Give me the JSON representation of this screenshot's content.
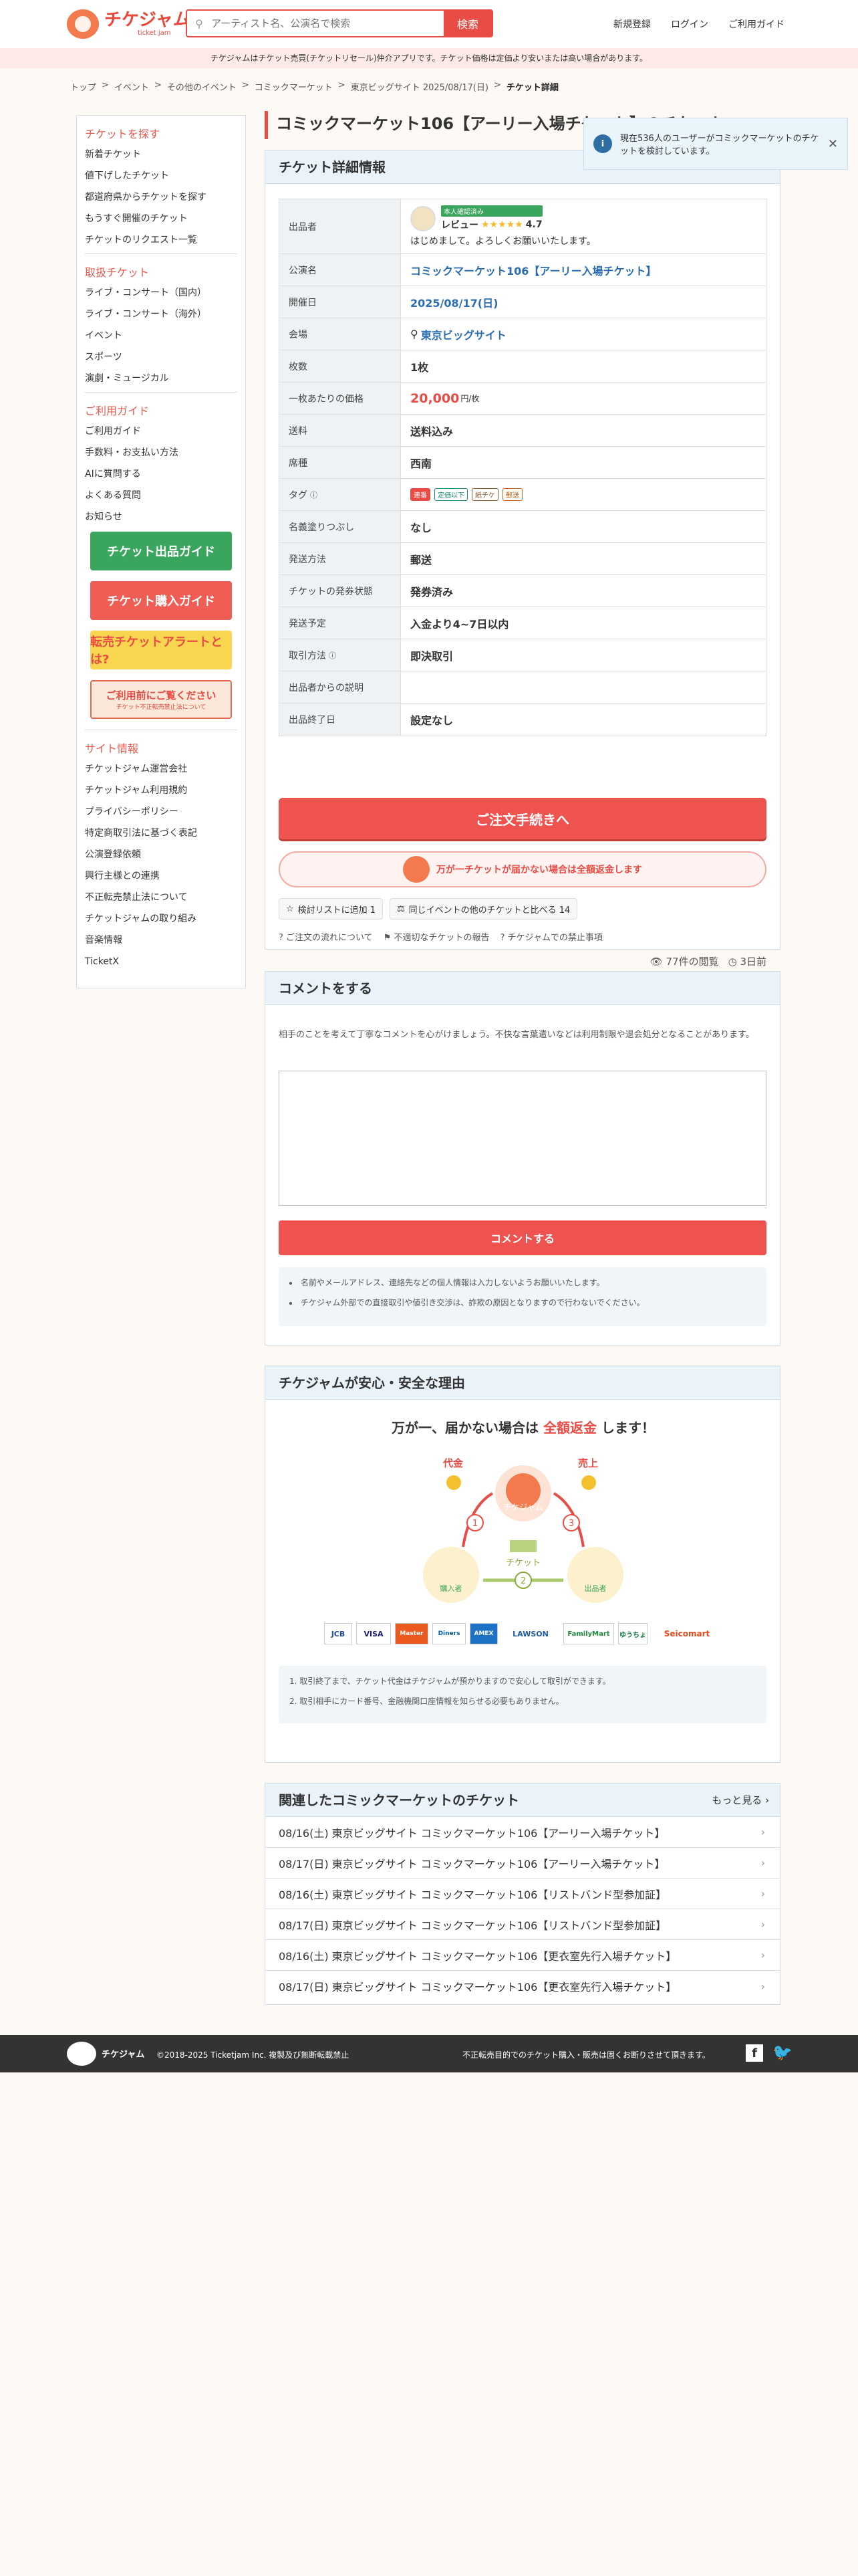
{
  "header": {
    "logo_text": "チケジャム",
    "logo_sub": "ticket jam",
    "search_placeholder": "アーティスト名、公演名で検索",
    "search_button": "検索",
    "nav": [
      "新規登録",
      "ログイン",
      "ご利用ガイド"
    ]
  },
  "notice": "チケジャムはチケット売買(チケットリセール)仲介アプリです。チケット価格は定価より安いまたは高い場合があります。",
  "breadcrumb": [
    "トップ",
    "イベント",
    "その他のイベント",
    "コミックマーケット",
    "東京ビッグサイト 2025/08/17(日)",
    "チケット詳細"
  ],
  "sidebar": {
    "find_title": "チケットを探す",
    "find_items": [
      "新着チケット",
      "値下げしたチケット",
      "都道府県からチケットを探す",
      "もうすぐ開催のチケット",
      "チケットのリクエスト一覧"
    ],
    "genre_title": "取扱チケット",
    "genre_items": [
      "ライブ・コンサート（国内）",
      "ライブ・コンサート（海外）",
      "イベント",
      "スポーツ",
      "演劇・ミュージカル"
    ],
    "guide_title": "ご利用ガイド",
    "guide_items": [
      "ご利用ガイド",
      "手数料・お支払い方法",
      "AIに質問する",
      "よくある質問",
      "お知らせ"
    ],
    "banners": [
      "チケット出品ガイド",
      "チケット購入ガイド",
      "転売チケットアラートとは?",
      "ご利用前にご覧ください"
    ],
    "banner4_sub": "チケット不正転売禁止法について",
    "site_title": "サイト情報",
    "site_items": [
      "チケットジャム運営会社",
      "チケットジャム利用規約",
      "プライバシーポリシー",
      "特定商取引法に基づく表記",
      "公演登録依頼",
      "興行主様との連携",
      "不正転売禁止法について",
      "チケットジャムの取り組み",
      "音楽情報",
      "TicketX"
    ]
  },
  "page_title": "コミックマーケット106【アーリー入場チケット】のチケット",
  "toast": "現在536人のユーザーがコミックマーケットのチケットを検討しています。",
  "detail": {
    "header": "チケット詳細情報",
    "seller_label": "出品者",
    "seller_badge": "本人確認済み",
    "seller_name": "レビュー",
    "seller_rating": "4.7",
    "seller_msg": "はじめまして。よろしくお願いいたします。",
    "rows": [
      {
        "label": "公演名",
        "value": "コミックマーケット106【アーリー入場チケット】"
      },
      {
        "label": "開催日",
        "value": "2025/08/17(日)"
      },
      {
        "label": "会場",
        "value": "東京ビッグサイト"
      },
      {
        "label": "枚数",
        "value": "1枚"
      },
      {
        "label": "一枚あたりの価格",
        "value": "20,000",
        "unit": "円/枚"
      },
      {
        "label": "送料",
        "value": "送料込み"
      },
      {
        "label": "席種",
        "value": "西南"
      },
      {
        "label": "タグ",
        "value": ""
      },
      {
        "label": "名義塗りつぶし",
        "value": "なし"
      },
      {
        "label": "発送方法",
        "value": "郵送"
      },
      {
        "label": "チケットの発券状態",
        "value": "発券済み"
      },
      {
        "label": "発送予定",
        "value": "入金より4~7日以内"
      },
      {
        "label": "取引方法",
        "value": "即決取引"
      },
      {
        "label": "出品者からの説明",
        "value": ""
      },
      {
        "label": "出品終了日",
        "value": "設定なし"
      }
    ],
    "tags": [
      "連番",
      "定価以下",
      "紙チケ",
      "郵送"
    ],
    "order_button": "ご注文手続きへ",
    "guarantee": "万が一チケットが届かない場合は全額返金します",
    "wishlist": "検討リストに追加 1",
    "compare": "同じイベントの他のチケットと比べる 14",
    "links": [
      "ご注文の流れについて",
      "不適切なチケットの報告",
      "チケジャムでの禁止事項"
    ],
    "views": "77件の閲覧",
    "posted": "3日前"
  },
  "comment": {
    "header": "コメントをする",
    "note": "相手のことを考えて丁寧なコメントを心がけましょう。不快な言葉遣いなどは利用制限や退会処分となることがあります。",
    "button": "コメントする",
    "bullets": [
      "名前やメールアドレス、連絡先などの個人情報は入力しないようお願いいたします。",
      "チケジャム外部での直接取引や値引き交渉は、詐欺の原因となりますので行わないでください。"
    ]
  },
  "safety": {
    "header": "チケジャムが安心・安全な理由",
    "title_pre": "万が一、届かない場合は",
    "title_em": "全額返金",
    "title_post": "します！",
    "labels": [
      "代金",
      "売上",
      "チケット",
      "チケジャム",
      "出品者",
      "購入者"
    ],
    "payments": [
      "JCB",
      "VISA",
      "Master",
      "Diners",
      "AMEX",
      "LAWSON",
      "FamilyMart",
      "ゆうちょ",
      "Seicomart"
    ],
    "notes": [
      "取引終了まで、チケット代金はチケジャムが預かりますので安心して取引ができます。",
      "取引相手にカード番号、金融機関口座情報を知らせる必要もありません。"
    ]
  },
  "related": {
    "header": "関連したコミックマーケットのチケット",
    "more": "もっと見る",
    "items": [
      "08/16(土) 東京ビッグサイト コミックマーケット106【アーリー入場チケット】",
      "08/17(日) 東京ビッグサイト コミックマーケット106【アーリー入場チケット】",
      "08/16(土) 東京ビッグサイト コミックマーケット106【リストバンド型参加証】",
      "08/17(日) 東京ビッグサイト コミックマーケット106【リストバンド型参加証】",
      "08/16(土) 東京ビッグサイト コミックマーケット106【更衣室先行入場チケット】",
      "08/17(日) 東京ビッグサイト コミックマーケット106【更衣室先行入場チケット】"
    ]
  },
  "footer": {
    "copyright": "©2018-2025 Ticketjam Inc. 複製及び無断転載禁止",
    "notice": "不正転売目的でのチケット購入・販売は固くお断りさせて頂きます。"
  }
}
